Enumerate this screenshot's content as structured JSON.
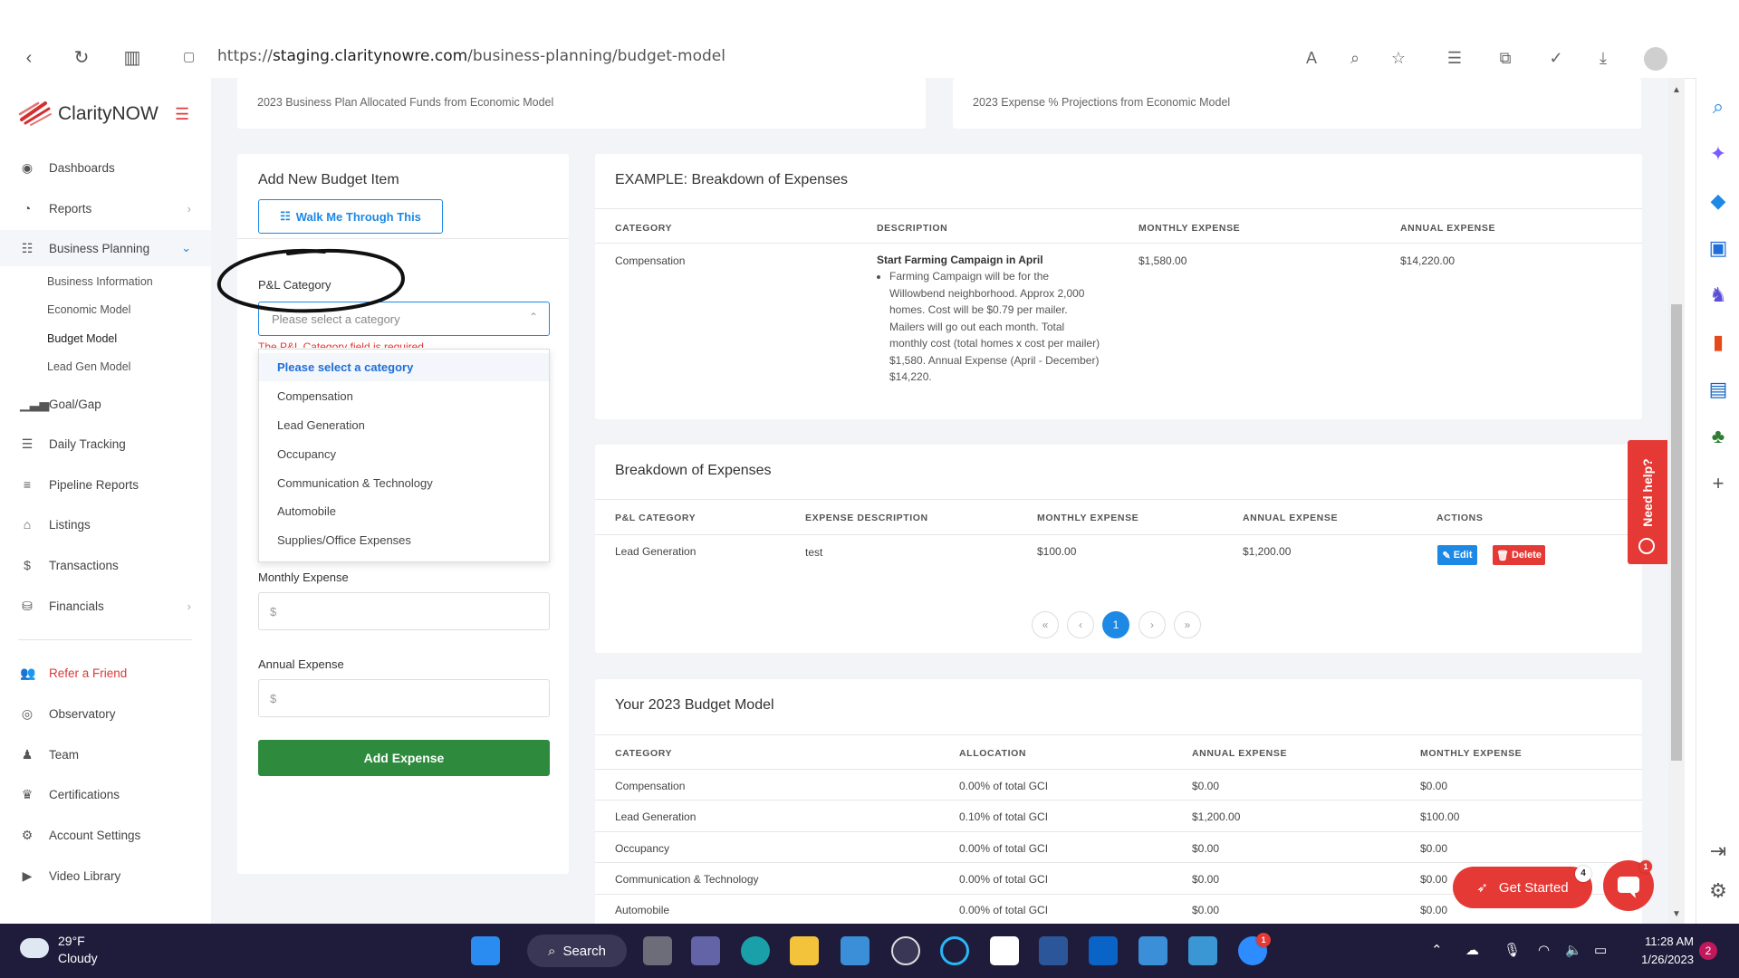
{
  "browser": {
    "url_prefix": "https://",
    "url_host": "staging.claritynowre.com",
    "url_path": "/business-planning/budget-model"
  },
  "sidebar": {
    "logo_text": "ClarityNOW",
    "items": [
      {
        "label": "Dashboards",
        "icon": "palette-icon"
      },
      {
        "label": "Reports",
        "icon": "pie-chart-icon"
      },
      {
        "label": "Business Planning",
        "icon": "list-check-icon"
      },
      {
        "label": "Goal/Gap",
        "icon": "bar-signal-icon"
      },
      {
        "label": "Daily Tracking",
        "icon": "list-icon"
      },
      {
        "label": "Pipeline Reports",
        "icon": "lines-icon"
      },
      {
        "label": "Listings",
        "icon": "home-icon"
      },
      {
        "label": "Transactions",
        "icon": "dollar-icon"
      },
      {
        "label": "Financials",
        "icon": "coins-icon"
      },
      {
        "label": "Refer a Friend",
        "icon": "users-icon"
      },
      {
        "label": "Observatory",
        "icon": "eye-icon"
      },
      {
        "label": "Team",
        "icon": "team-icon"
      },
      {
        "label": "Certifications",
        "icon": "crown-icon"
      },
      {
        "label": "Account Settings",
        "icon": "gear-icon"
      },
      {
        "label": "Video Library",
        "icon": "play-icon"
      }
    ],
    "subitems": [
      "Business Information",
      "Economic Model",
      "Budget Model",
      "Lead Gen Model"
    ]
  },
  "top_cards": {
    "left": "2023 Business Plan Allocated Funds from Economic Model",
    "right": "2023 Expense % Projections from Economic Model"
  },
  "form": {
    "title": "Add New Budget Item",
    "walk_button": "Walk Me Through This",
    "category_label": "P&L Category",
    "category_placeholder": "Please select a category",
    "category_error": "The P&L Category field is required",
    "options": [
      "Please select a category",
      "Compensation",
      "Lead Generation",
      "Occupancy",
      "Communication & Technology",
      "Automobile",
      "Supplies/Office Expenses"
    ],
    "monthly_label": "Monthly Expense",
    "annual_label": "Annual Expense",
    "currency_symbol": "$",
    "submit": "Add Expense"
  },
  "example": {
    "title": "EXAMPLE: Breakdown of Expenses",
    "headers": [
      "CATEGORY",
      "DESCRIPTION",
      "MONTHLY EXPENSE",
      "ANNUAL EXPENSE"
    ],
    "row": {
      "category": "Compensation",
      "desc_title": "Start Farming Campaign in April",
      "desc_body": "Farming Campaign will be for the Willowbend neighborhood. Approx 2,000 homes. Cost will be $0.79 per mailer. Mailers will go out each month. Total monthly cost (total homes x cost per mailer) $1,580. Annual Expense (April - December) $14,220.",
      "monthly": "$1,580.00",
      "annual": "$14,220.00"
    }
  },
  "breakdown": {
    "title": "Breakdown of Expenses",
    "headers": [
      "P&L CATEGORY",
      "EXPENSE DESCRIPTION",
      "MONTHLY EXPENSE",
      "ANNUAL EXPENSE",
      "ACTIONS"
    ],
    "row": {
      "category": "Lead Generation",
      "description": "test",
      "monthly": "$100.00",
      "annual": "$1,200.00"
    },
    "edit": "Edit",
    "delete": "Delete",
    "pagination": [
      "«",
      "‹",
      "1",
      "›",
      "»"
    ]
  },
  "budget_model": {
    "title": "Your 2023 Budget Model",
    "headers": [
      "CATEGORY",
      "ALLOCATION",
      "ANNUAL EXPENSE",
      "MONTHLY EXPENSE"
    ],
    "rows": [
      [
        "Compensation",
        "0.00% of total GCI",
        "$0.00",
        "$0.00"
      ],
      [
        "Lead Generation",
        "0.10% of total GCI",
        "$1,200.00",
        "$100.00"
      ],
      [
        "Occupancy",
        "0.00% of total GCI",
        "$0.00",
        "$0.00"
      ],
      [
        "Communication & Technology",
        "0.00% of total GCI",
        "$0.00",
        "$0.00"
      ],
      [
        "Automobile",
        "0.00% of total GCI",
        "$0.00",
        "$0.00"
      ]
    ]
  },
  "widgets": {
    "need_help": "Need help?",
    "get_started": "Get Started",
    "get_started_badge": "4",
    "chat_badge": "1"
  },
  "taskbar": {
    "temp": "29°F",
    "condition": "Cloudy",
    "search": "Search",
    "time": "11:28 AM",
    "date": "1/26/2023",
    "notif": "2",
    "app_badge": "1"
  },
  "colors": {
    "accent": "#1e88e5",
    "brand_red": "#e53935",
    "success": "#2e8b3e"
  }
}
